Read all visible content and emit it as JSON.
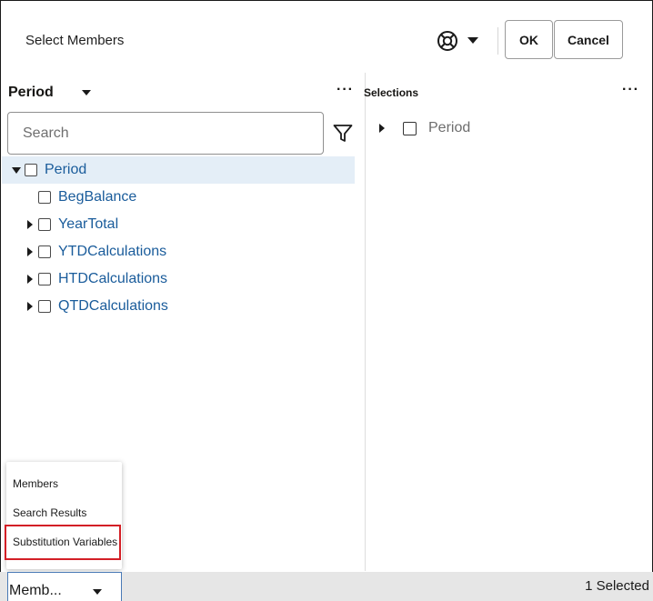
{
  "dialog": {
    "title": "Select Members",
    "ok_label": "OK",
    "cancel_label": "Cancel",
    "help_icon": "lifebuoy-icon"
  },
  "left_panel": {
    "dimension": "Period",
    "search_placeholder": "Search",
    "tree": [
      {
        "label": "Period",
        "state": "expanded",
        "checked": false,
        "selected": true
      },
      {
        "label": "BegBalance",
        "state": "leaf",
        "checked": false
      },
      {
        "label": "YearTotal",
        "state": "collapsed",
        "checked": false
      },
      {
        "label": "YTDCalculations",
        "state": "collapsed",
        "checked": false
      },
      {
        "label": "HTDCalculations",
        "state": "collapsed",
        "checked": false
      },
      {
        "label": "QTDCalculations",
        "state": "collapsed",
        "checked": false
      }
    ]
  },
  "right_panel": {
    "header": "Selections",
    "items": [
      {
        "label": "Period",
        "state": "collapsed",
        "checked": false
      }
    ]
  },
  "view_menu": {
    "options": [
      "Members",
      "Search Results",
      "Substitution Variables"
    ],
    "highlighted": "Substitution Variables",
    "current_value": "Memb..."
  },
  "footer": {
    "selected_count": "1 Selected"
  },
  "colors": {
    "link": "#1a5c9b",
    "highlight_border": "#d31f26",
    "selected_row": "#e4eef7",
    "footer_bg": "#e6e6e6"
  }
}
